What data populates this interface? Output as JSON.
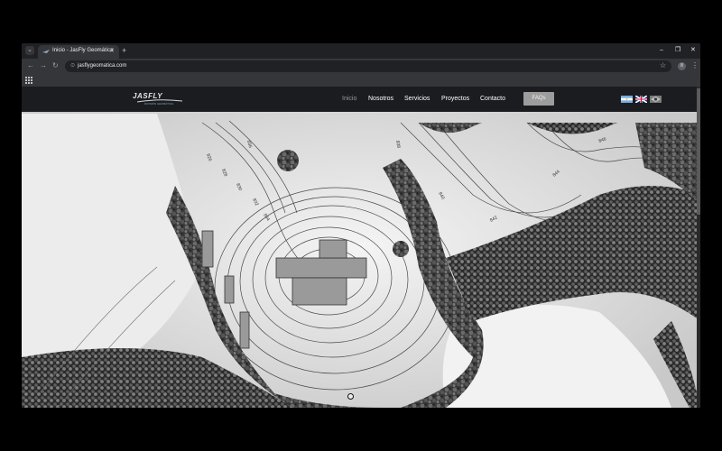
{
  "browser": {
    "tab_title": "Inicio - JasFly Geomática",
    "tab_menu_glyph": "⌄",
    "close_glyph": "✕",
    "new_tab_glyph": "+",
    "window_controls": {
      "minimize": "–",
      "maximize": "❐",
      "close": "✕"
    },
    "nav": {
      "back": "←",
      "forward": "→",
      "reload": "↻"
    },
    "address": "jasflygeomatica.com",
    "site_info_glyph": "⊙",
    "bookmark_glyph": "☆",
    "profile_initial": "8",
    "menu_glyph": "⋮"
  },
  "site": {
    "logo_text": "JASFLY",
    "logo_sub": "DIVISIÓN GEOMÁTICA",
    "menu": [
      "Inicio",
      "Nosotros",
      "Servicios",
      "Proyectos",
      "Contacto"
    ],
    "active_menu": "Inicio",
    "faq_label": "FAQs",
    "languages": [
      "argentina-flag",
      "uk-flag",
      "brazil-flag"
    ],
    "contour_labels": [
      "826",
      "828",
      "830",
      "832",
      "834",
      "836",
      "838",
      "840",
      "842",
      "844",
      "846"
    ]
  },
  "colors": {
    "chrome_bg": "#202124",
    "toolbar_bg": "#35363a",
    "site_nav_bg": "#1a1c1f",
    "faq_button": "#9d9d9d"
  }
}
